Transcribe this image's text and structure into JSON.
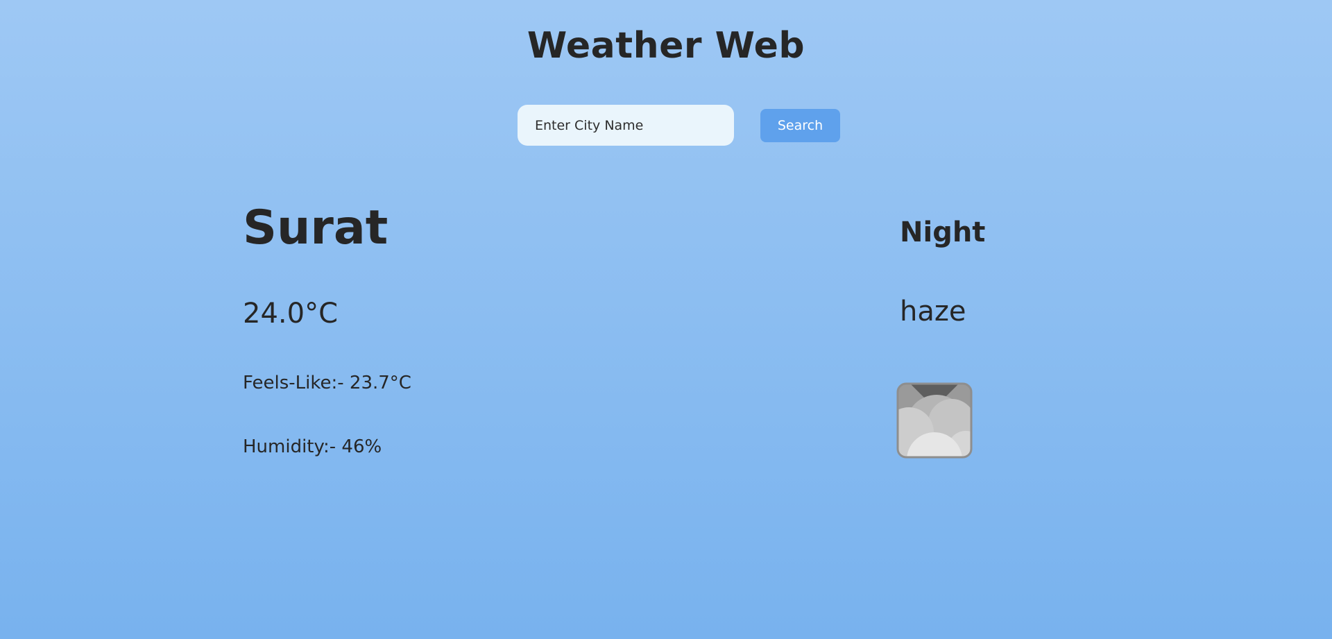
{
  "header": {
    "title": "Weather Web"
  },
  "search": {
    "placeholder": "Enter City Name",
    "value": "",
    "button_label": "Search"
  },
  "weather": {
    "city": "Surat",
    "temperature": "24.0°C",
    "feels_like": "Feels-Like:- 23.7°C",
    "humidity": "Humidity:- 46%",
    "time_of_day": "Night",
    "condition": "haze",
    "icon": "haze-clouds-icon"
  },
  "colors": {
    "background_top": "#9ec8f4",
    "background_bottom": "#78b2ee",
    "button": "#5fa1ec",
    "input_background": "#eaf5fc",
    "text": "#262626"
  }
}
